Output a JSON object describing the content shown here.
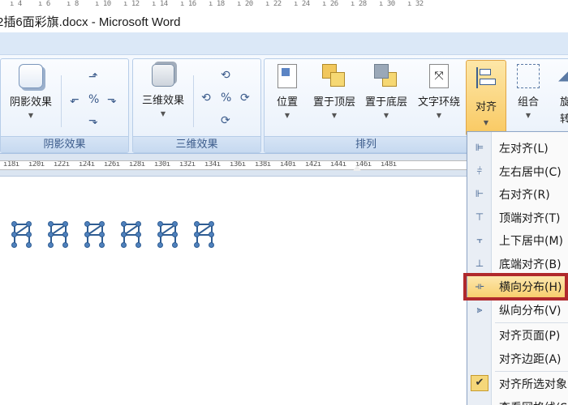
{
  "top_ruler": {
    "ticks": [
      "4",
      "6",
      "8",
      "10",
      "12",
      "14",
      "16",
      "18",
      "20",
      "22",
      "24",
      "26",
      "28",
      "30",
      "32"
    ]
  },
  "window": {
    "title": "2插6面彩旗.docx - Microsoft Word"
  },
  "ribbon": {
    "groups": {
      "shadow": {
        "label": "阴影效果",
        "big_button": "阴影效果"
      },
      "three_d": {
        "label": "三维效果",
        "big_button": "三维效果"
      },
      "arrange": {
        "label": "排列",
        "buttons": {
          "position": "位置",
          "bring_to_front": "置于顶层",
          "send_to_back": "置于底层",
          "text_wrapping": "文字环绕",
          "align": "对齐",
          "group": "组合",
          "rotate_partial": "旋"
        },
        "rotate_partial_2": "转"
      }
    }
  },
  "ruler": {
    "ticks": [
      "18",
      "20",
      "22",
      "24",
      "26",
      "28",
      "30",
      "32",
      "34",
      "36",
      "38",
      "40",
      "42",
      "44",
      "46",
      "48"
    ]
  },
  "document": {
    "flag_count": 6
  },
  "align_menu": {
    "items": [
      {
        "label": "左对齐(L)",
        "icon": "align-left-icon"
      },
      {
        "label": "左右居中(C)",
        "icon": "align-center-icon"
      },
      {
        "label": "右对齐(R)",
        "icon": "align-right-icon"
      },
      {
        "label": "顶端对齐(T)",
        "icon": "align-top-icon"
      },
      {
        "label": "上下居中(M)",
        "icon": "align-middle-icon"
      },
      {
        "label": "底端对齐(B)",
        "icon": "align-bottom-icon"
      },
      {
        "label": "横向分布(H)",
        "icon": "distribute-horizontal-icon",
        "highlighted": true
      },
      {
        "label": "纵向分布(V)",
        "icon": "distribute-vertical-icon"
      },
      {
        "label": "对齐页面(P)",
        "icon": ""
      },
      {
        "label": "对齐边距(A)",
        "icon": ""
      },
      {
        "label": "对齐所选对象(O)",
        "icon": "checkmark-icon",
        "checked": true
      },
      {
        "label": "查看网格线(S)",
        "icon": ""
      }
    ]
  },
  "colors": {
    "highlight": "#f8cf6e",
    "annotation_box": "#b0292c",
    "ribbon_label": "#3a5a8a"
  }
}
